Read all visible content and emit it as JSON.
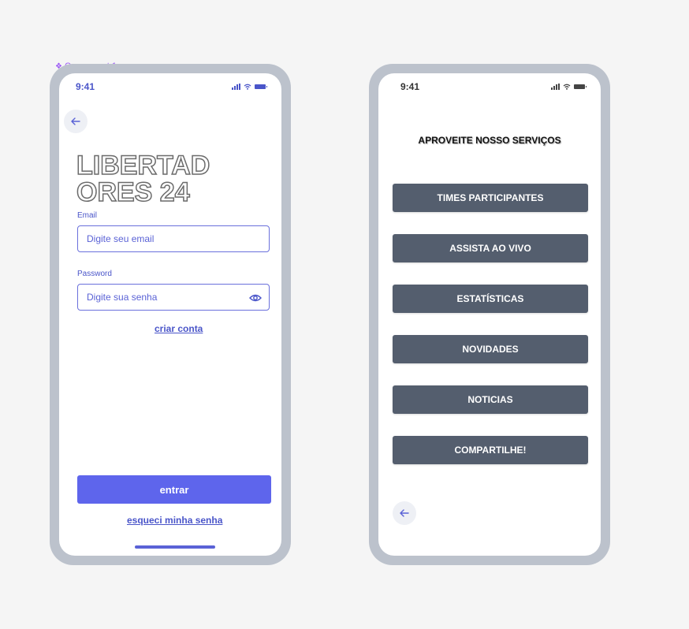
{
  "component_label": "Component 1",
  "login_screen": {
    "status_time": "9:41",
    "title": "LIBERTADORES 24",
    "email": {
      "label": "Email",
      "placeholder": "Digite seu email"
    },
    "password": {
      "label": "Password",
      "placeholder": "Digite sua senha"
    },
    "create_account": "criar conta",
    "submit": "entrar",
    "forgot_password": "esqueci minha senha"
  },
  "services_screen": {
    "status_time": "9:41",
    "title": "APROVEITE NOSSO SERVIÇOS",
    "menu": [
      "TIMES PARTICIPANTES",
      "ASSISTA AO VIVO",
      "ESTATÍSTICAS",
      "NOVIDADES",
      "NOTICIAS",
      "COMPARTILHE!"
    ]
  },
  "icons": {
    "back": "arrow-left-icon",
    "eye": "eye-icon",
    "signal": "signal-icon",
    "wifi": "wifi-icon",
    "battery": "battery-icon"
  },
  "colors": {
    "accent": "#5e65ec",
    "menu_button": "#545e6e",
    "device_frame": "#bcc2cc",
    "component_label": "#9b59f5"
  }
}
